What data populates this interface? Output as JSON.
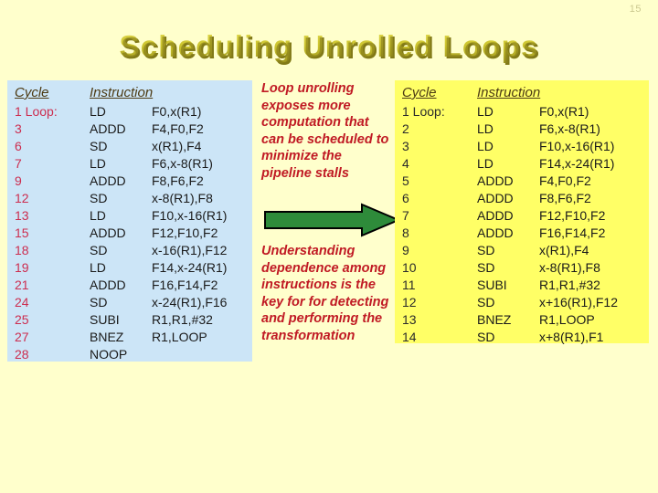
{
  "slide": {
    "page_number": "15",
    "title": "Scheduling Unrolled Loops",
    "background_color": "#ffffcc",
    "title_color": "#cdc52f"
  },
  "left_panel": {
    "name": "unrolled-not-scheduled",
    "background_color": "#cce5f7",
    "cycle_color": "#cc2d4f",
    "headers": {
      "cycle": "Cycle",
      "instruction": "Instruction"
    },
    "rows": [
      {
        "cycle": "1 Loop:",
        "op": "LD",
        "args": "F0,x(R1)"
      },
      {
        "cycle": "3",
        "op": "ADDD",
        "args": "F4,F0,F2"
      },
      {
        "cycle": "6",
        "op": "SD",
        "args": "x(R1),F4"
      },
      {
        "cycle": "7",
        "op": "LD",
        "args": "F6,x-8(R1)"
      },
      {
        "cycle": "9",
        "op": "ADDD",
        "args": "F8,F6,F2"
      },
      {
        "cycle": "12",
        "op": "SD",
        "args": "x-8(R1),F8"
      },
      {
        "cycle": "13",
        "op": "LD",
        "args": "F10,x-16(R1)"
      },
      {
        "cycle": "15",
        "op": "ADDD",
        "args": "F12,F10,F2"
      },
      {
        "cycle": "18",
        "op": "SD",
        "args": "x-16(R1),F12"
      },
      {
        "cycle": "19",
        "op": "LD",
        "args": "F14,x-24(R1)"
      },
      {
        "cycle": "21",
        "op": "ADDD",
        "args": "F16,F14,F2"
      },
      {
        "cycle": "24",
        "op": "SD",
        "args": "x-24(R1),F16"
      },
      {
        "cycle": "25",
        "op": "SUBI",
        "args": "R1,R1,#32"
      },
      {
        "cycle": "27",
        "op": "BNEZ",
        "args": "R1,LOOP"
      },
      {
        "cycle": "28",
        "op": "NOOP",
        "args": ""
      }
    ]
  },
  "middle": {
    "paragraph1": "Loop unrolling exposes more computation that can be scheduled to minimize the pipeline stalls",
    "paragraph2": "Understanding dependence among instructions is the key for for detecting and performing the transformation",
    "text_color": "#c01a24",
    "arrow": {
      "name": "green-right-arrow",
      "fill_color": "#2e8b3a",
      "outline_color": "#000000"
    }
  },
  "right_panel": {
    "name": "unrolled-and-scheduled",
    "background_color": "#ffff66",
    "cycle_color": "#2b2b2b",
    "headers": {
      "cycle": "Cycle",
      "instruction": "Instruction"
    },
    "rows": [
      {
        "cycle": "1 Loop:",
        "op": "LD",
        "args": "F0,x(R1)"
      },
      {
        "cycle": "2",
        "op": "LD",
        "args": "F6,x-8(R1)"
      },
      {
        "cycle": "3",
        "op": "LD",
        "args": "F10,x-16(R1)"
      },
      {
        "cycle": "4",
        "op": "LD",
        "args": "F14,x-24(R1)"
      },
      {
        "cycle": "5",
        "op": "ADDD",
        "args": "F4,F0,F2"
      },
      {
        "cycle": "6",
        "op": "ADDD",
        "args": "F8,F6,F2"
      },
      {
        "cycle": "7",
        "op": "ADDD",
        "args": "F12,F10,F2"
      },
      {
        "cycle": "8",
        "op": "ADDD",
        "args": "F16,F14,F2"
      },
      {
        "cycle": "9",
        "op": "SD",
        "args": "x(R1),F4"
      },
      {
        "cycle": "10",
        "op": "SD",
        "args": "x-8(R1),F8"
      },
      {
        "cycle": "11",
        "op": "SUBI",
        "args": "R1,R1,#32"
      },
      {
        "cycle": "12",
        "op": "SD",
        "args": "x+16(R1),F12"
      },
      {
        "cycle": "13",
        "op": "BNEZ",
        "args": "R1,LOOP"
      },
      {
        "cycle": "14",
        "op": "SD",
        "args": "x+8(R1),F1"
      }
    ]
  }
}
